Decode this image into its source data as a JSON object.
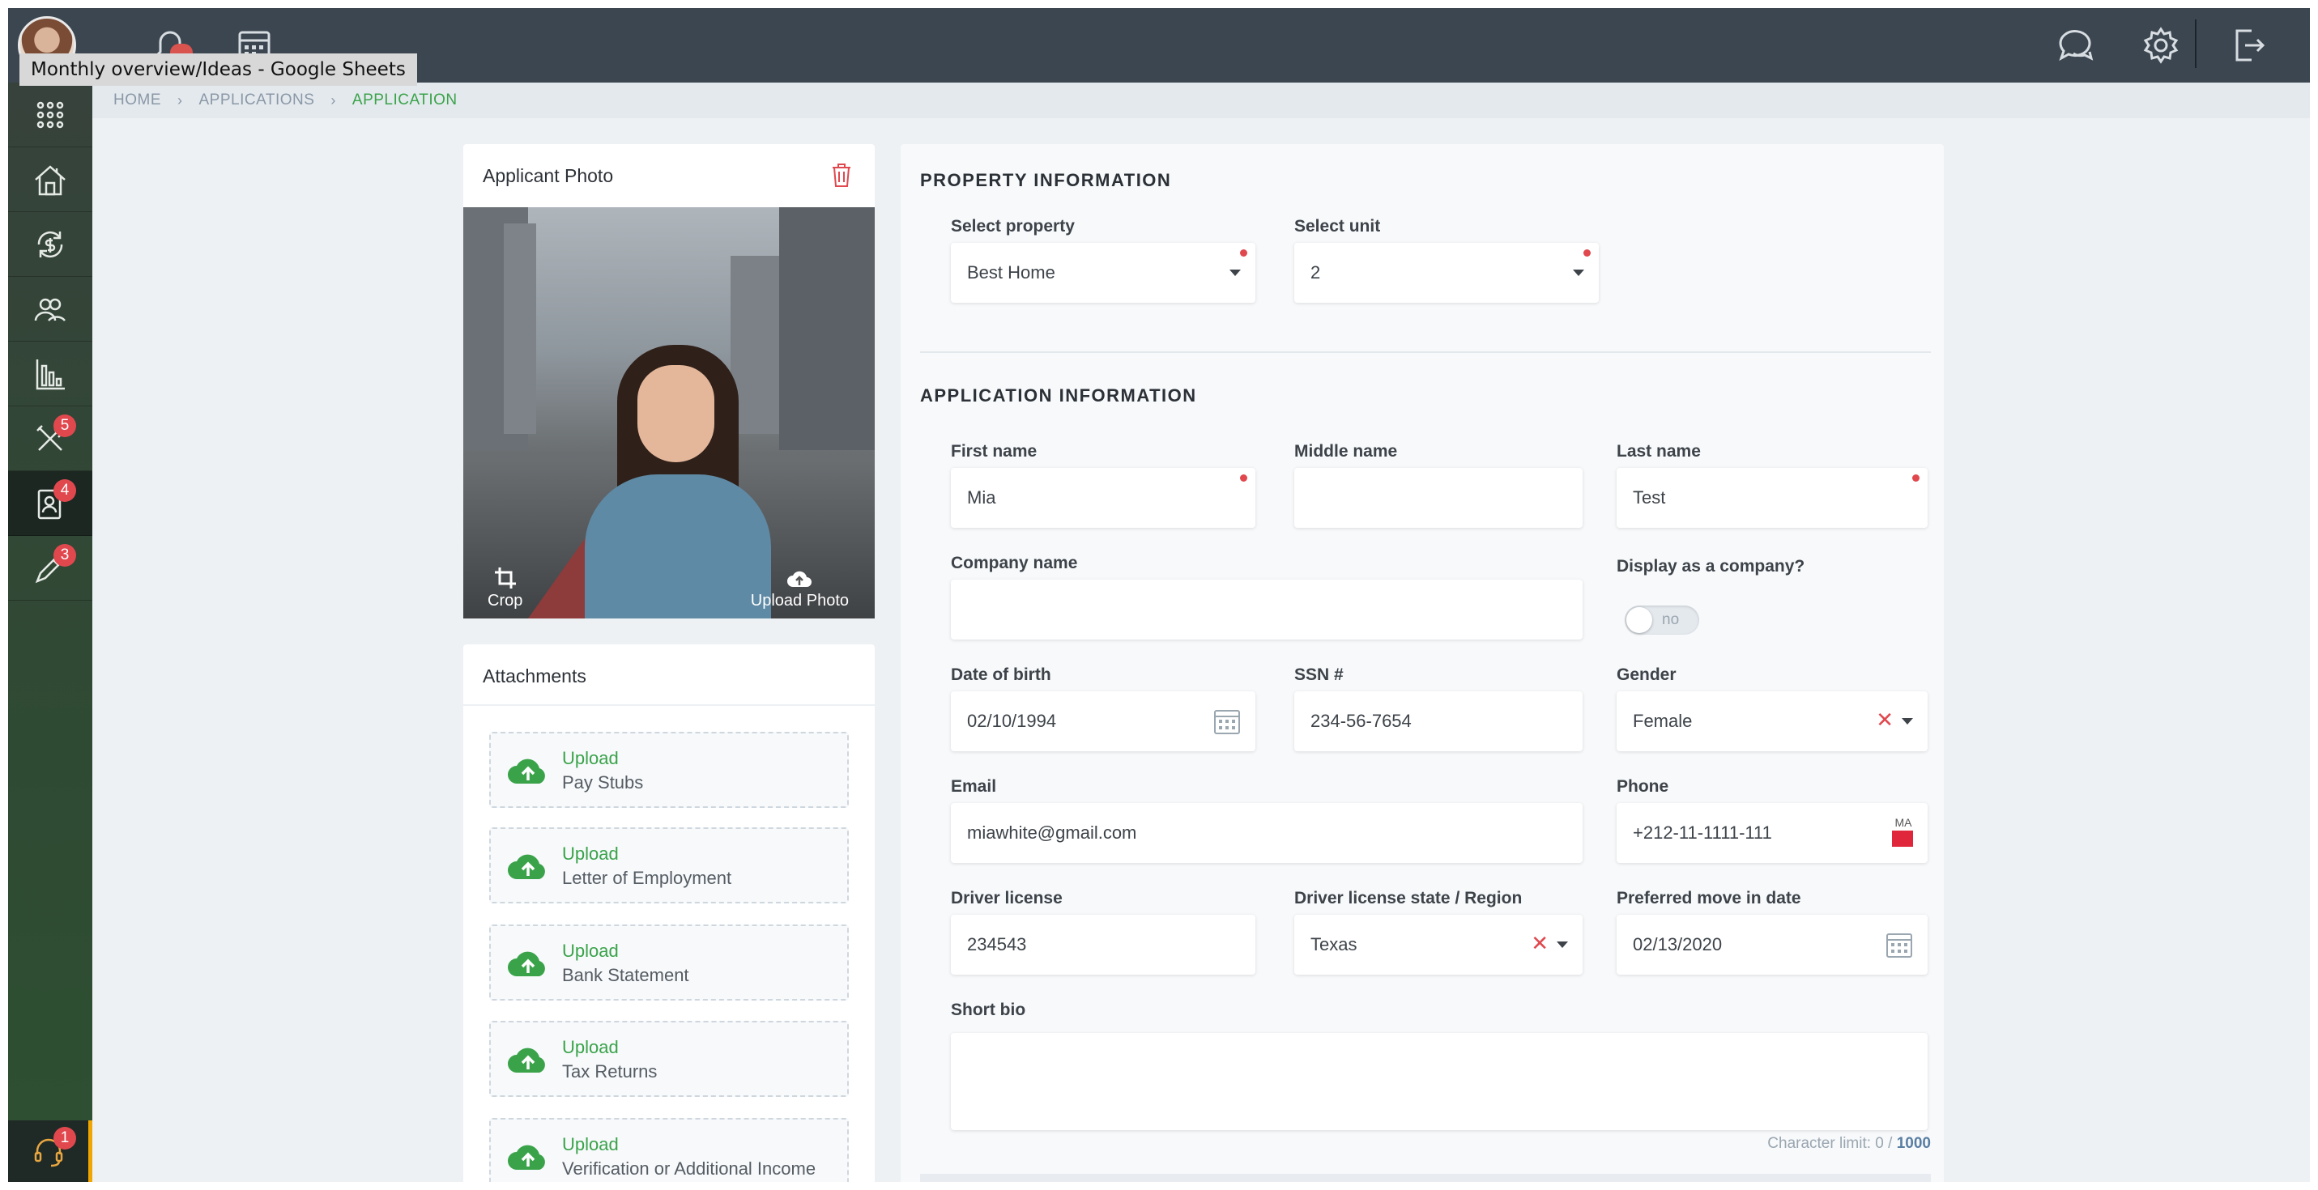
{
  "topbar": {
    "tooltip": "Monthly overview/Ideas - Google Sheets",
    "icons": [
      "user-avatar",
      "bell-icon",
      "calendar-icon",
      "chat-icon",
      "gear-icon",
      "logout-icon"
    ]
  },
  "sidebar": {
    "items": [
      {
        "icon": "apps-grid-icon",
        "badge": null
      },
      {
        "icon": "property-icon",
        "badge": null
      },
      {
        "icon": "finance-icon",
        "badge": null
      },
      {
        "icon": "people-icon",
        "badge": null
      },
      {
        "icon": "reports-icon",
        "badge": null
      },
      {
        "icon": "tools-icon",
        "badge": "5"
      },
      {
        "icon": "applications-icon",
        "badge": "4"
      },
      {
        "icon": "edit-icon",
        "badge": "3"
      }
    ],
    "support_badge": "1"
  },
  "breadcrumb": {
    "home": "HOME",
    "applications": "APPLICATIONS",
    "current": "APPLICATION"
  },
  "photo_card": {
    "title": "Applicant Photo",
    "crop_label": "Crop",
    "upload_label": "Upload Photo"
  },
  "attachments": {
    "title": "Attachments",
    "items": [
      {
        "action": "Upload",
        "name": "Pay Stubs"
      },
      {
        "action": "Upload",
        "name": "Letter of Employment"
      },
      {
        "action": "Upload",
        "name": "Bank Statement"
      },
      {
        "action": "Upload",
        "name": "Tax Returns"
      },
      {
        "action": "Upload",
        "name": "Verification or Additional Income"
      }
    ]
  },
  "property": {
    "section_title": "PROPERTY INFORMATION",
    "property_label": "Select property",
    "property_value": "Best Home",
    "unit_label": "Select unit",
    "unit_value": "2"
  },
  "application": {
    "section_title": "APPLICATION INFORMATION",
    "first_name_label": "First name",
    "first_name_value": "Mia",
    "middle_name_label": "Middle name",
    "middle_name_value": "",
    "last_name_label": "Last name",
    "last_name_value": "Test",
    "company_label": "Company name",
    "company_value": "",
    "display_company_label": "Display as a company?",
    "display_company_toggle": "no",
    "dob_label": "Date of birth",
    "dob_value": "02/10/1994",
    "ssn_label": "SSN #",
    "ssn_value": "234-56-7654",
    "gender_label": "Gender",
    "gender_value": "Female",
    "email_label": "Email",
    "email_value": "miawhite@gmail.com",
    "phone_label": "Phone",
    "phone_value": "+212-11-1111-111",
    "phone_country": "MA",
    "license_label": "Driver license",
    "license_value": "234543",
    "license_state_label": "Driver license state / Region",
    "license_state_value": "Texas",
    "move_date_label": "Preferred move in date",
    "move_date_value": "02/13/2020",
    "bio_label": "Short bio",
    "bio_value": "",
    "char_limit_prefix": "Character limit: 0 / ",
    "char_limit_max": "1000"
  },
  "colors": {
    "topbar": "#3b4650",
    "sidebar": "#2f4a33",
    "accent_green": "#3aa34a",
    "badge_red": "#e0484e"
  }
}
